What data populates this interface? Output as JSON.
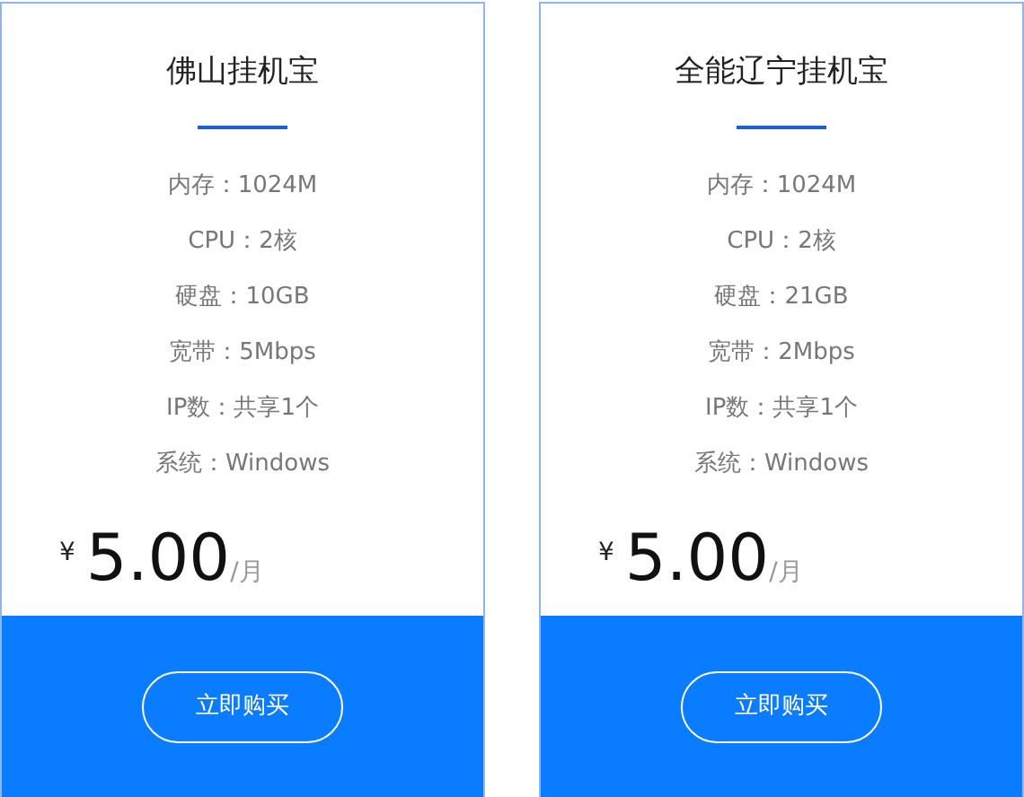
{
  "plans": [
    {
      "title": "佛山挂机宝",
      "specs": [
        "内存：1024M",
        "CPU：2核",
        "硬盘：10GB",
        "宽带：5Mbps",
        "IP数：共享1个",
        "系统：Windows"
      ],
      "currency": "¥",
      "price": "5.00",
      "unit": "/月",
      "button": "立即购买"
    },
    {
      "title": "全能辽宁挂机宝",
      "specs": [
        "内存：1024M",
        "CPU：2核",
        "硬盘：21GB",
        "宽带：2Mbps",
        "IP数：共享1个",
        "系统：Windows"
      ],
      "currency": "¥",
      "price": "5.00",
      "unit": "/月",
      "button": "立即购买"
    }
  ]
}
